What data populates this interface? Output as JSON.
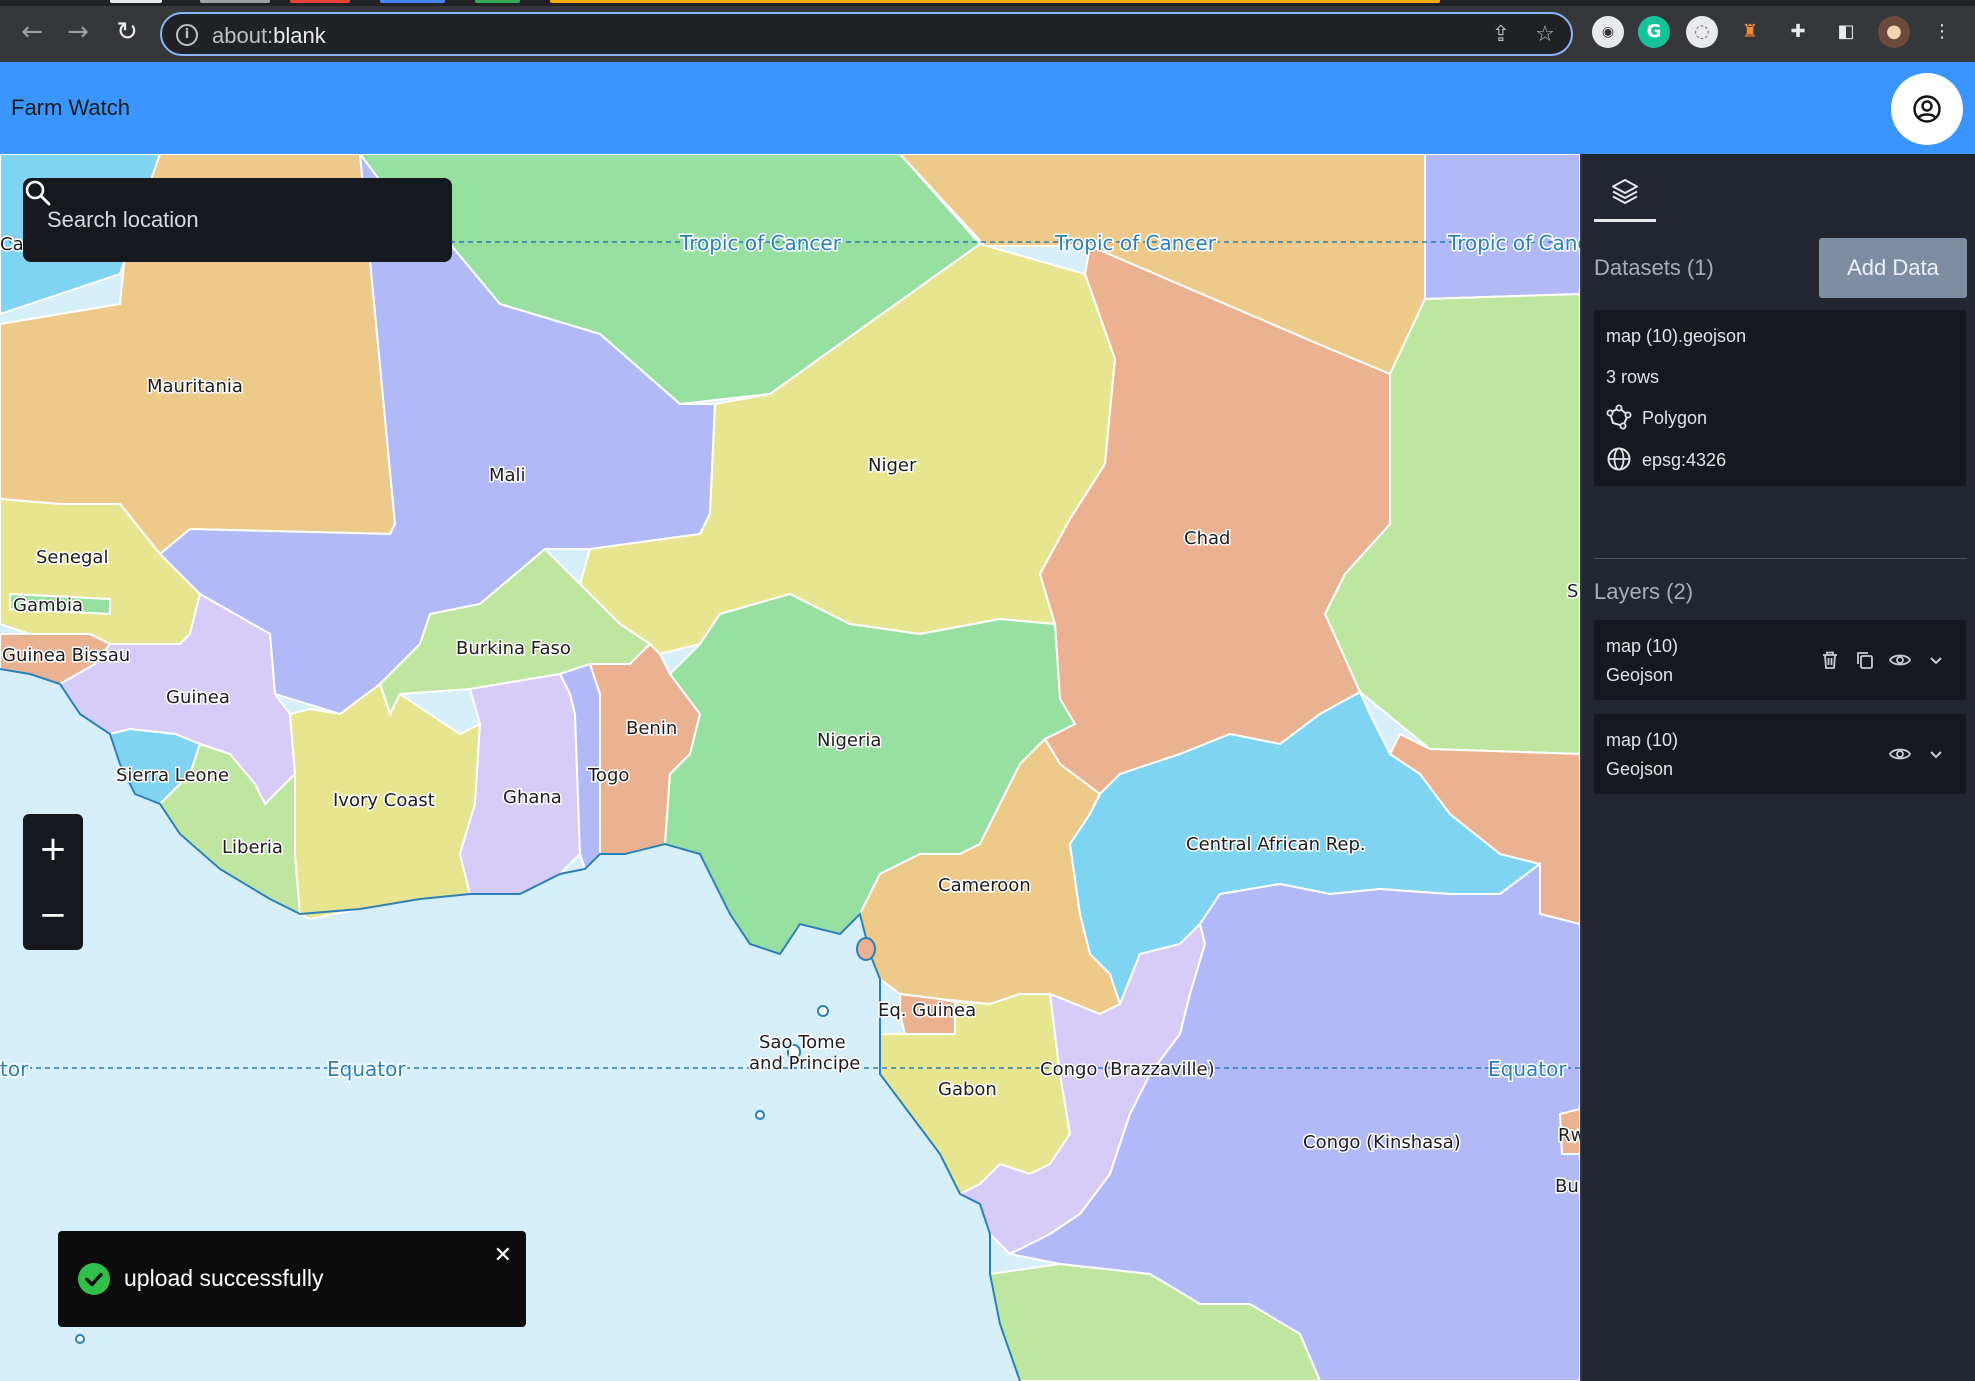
{
  "browser": {
    "url_scheme": "about:",
    "url_path": "blank"
  },
  "header": {
    "title": "Farm Watch"
  },
  "map": {
    "search_placeholder": "Search location",
    "zoom_in": "+",
    "zoom_out": "−",
    "lines": {
      "tropic": "Tropic of Cancer",
      "tropic_cut": "Tropic of Canc",
      "equator": "Equator",
      "equator_cut": "tor"
    },
    "labels": {
      "mauritania": "Mauritania",
      "mali": "Mali",
      "niger": "Niger",
      "chad": "Chad",
      "senegal": "Senegal",
      "gambia": "Gambia",
      "guinea_bissau": "Guinea Bissau",
      "guinea": "Guinea",
      "burkina_faso": "Burkina Faso",
      "benin": "Benin",
      "nigeria": "Nigeria",
      "sierra_leone": "Sierra Leone",
      "togo": "Togo",
      "ghana": "Ghana",
      "ivory_coast": "Ivory Coast",
      "liberia": "Liberia",
      "car": "Central African Rep.",
      "cameroon": "Cameroon",
      "eq_guinea": "Eq. Guinea",
      "sao_tome_1": "Sao Tome",
      "sao_tome_2": "and Principe",
      "gabon": "Gabon",
      "congo_b": "Congo (Brazzaville)",
      "congo_k": "Congo (Kinshasa)",
      "cut_ca": "Ca",
      "cut_s": "S",
      "cut_rw": "Rw",
      "cut_bu": "Bu"
    },
    "toast": {
      "message": "upload successfully",
      "close": "✕"
    }
  },
  "panel": {
    "datasets_heading": "Datasets (1)",
    "add_data_label": "Add Data",
    "dataset": {
      "filename": "map (10).geojson",
      "rows": "3 rows",
      "geometry": "Polygon",
      "crs": "epsg:4326"
    },
    "layers_heading": "Layers (2)",
    "layers": [
      {
        "name": "map (10)",
        "type": "Geojson"
      },
      {
        "name": "map (10)",
        "type": "Geojson"
      }
    ]
  },
  "colors": {
    "header": "#3a95ff",
    "panel": "#222630",
    "ocean": "#d6effb",
    "toast_success": "#2fbf4a"
  }
}
